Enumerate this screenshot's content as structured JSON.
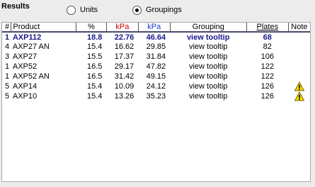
{
  "header": {
    "title": "Results",
    "radio_units": "Units",
    "radio_groupings": "Groupings",
    "selected": "groupings"
  },
  "table": {
    "columns": [
      "#",
      "Product",
      "%",
      "kPa",
      "kPa",
      "Grouping",
      "Plates",
      "Note"
    ],
    "rows": [
      {
        "num": "1",
        "product": "AXP112",
        "pct": "18.8",
        "kpa1": "22.76",
        "kpa2": "46.64",
        "grouping": "view tooltip",
        "plates": "68",
        "note": ""
      },
      {
        "num": "4",
        "product": "AXP27 AN",
        "pct": "15.4",
        "kpa1": "16.62",
        "kpa2": "29.85",
        "grouping": "view tooltip",
        "plates": "82",
        "note": ""
      },
      {
        "num": "3",
        "product": "AXP27",
        "pct": "15.5",
        "kpa1": "17.37",
        "kpa2": "31.84",
        "grouping": "view tooltip",
        "plates": "106",
        "note": ""
      },
      {
        "num": "1",
        "product": "AXP52",
        "pct": "16.5",
        "kpa1": "29.17",
        "kpa2": "47.82",
        "grouping": "view tooltip",
        "plates": "122",
        "note": ""
      },
      {
        "num": "1",
        "product": "AXP52 AN",
        "pct": "16.5",
        "kpa1": "31.42",
        "kpa2": "49.15",
        "grouping": "view tooltip",
        "plates": "122",
        "note": ""
      },
      {
        "num": "5",
        "product": "AXP14",
        "pct": "15.4",
        "kpa1": "10.09",
        "kpa2": "24.12",
        "grouping": "view tooltip",
        "plates": "126",
        "note": "warning-icon"
      },
      {
        "num": "5",
        "product": "AXP10",
        "pct": "15.4",
        "kpa1": "13.26",
        "kpa2": "35.23",
        "grouping": "view tooltip",
        "plates": "126",
        "note": "warning-icon"
      }
    ]
  },
  "colors": {
    "kpa1": "#cc0000",
    "kpa2": "#1a3ad0",
    "highlight_row": "#1a1a8a"
  }
}
